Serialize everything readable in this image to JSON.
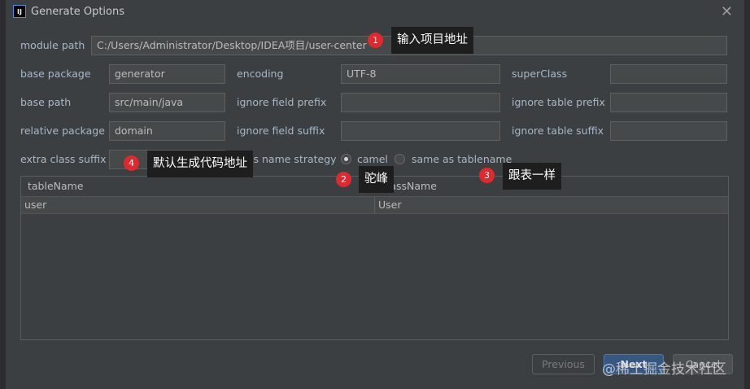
{
  "window": {
    "title": "Generate Options",
    "logo_text": "IJ"
  },
  "form": {
    "module_path": {
      "label": "module path",
      "value": "C:/Users/Administrator/Desktop/IDEA项目/user-center"
    },
    "base_package": {
      "label": "base package",
      "value": "generator"
    },
    "encoding": {
      "label": "encoding",
      "value": "UTF-8"
    },
    "super_class": {
      "label": "superClass",
      "value": ""
    },
    "base_path": {
      "label": "base path",
      "value": "src/main/java"
    },
    "ignore_field_prefix": {
      "label": "ignore field prefix",
      "value": ""
    },
    "ignore_table_prefix": {
      "label": "ignore table prefix",
      "value": ""
    },
    "relative_package": {
      "label": "relative package",
      "value": "domain"
    },
    "ignore_field_suffix": {
      "label": "ignore field suffix",
      "value": ""
    },
    "ignore_table_suffix": {
      "label": "ignore table suffix",
      "value": ""
    },
    "extra_class_suffix": {
      "label": "extra class suffix",
      "value": ""
    },
    "class_name_strategy": {
      "label": "class name strategy",
      "options": [
        "camel",
        "same as tablename"
      ],
      "selected": "camel"
    }
  },
  "table": {
    "columns": [
      "tableName",
      "className"
    ],
    "rows": [
      [
        "user",
        "User"
      ]
    ]
  },
  "buttons": {
    "previous": "Previous",
    "next": "Next",
    "cancel": "Cancel"
  },
  "annotations": [
    {
      "num": "1",
      "text": "输入项目地址"
    },
    {
      "num": "2",
      "text": "驼峰"
    },
    {
      "num": "3",
      "text": "跟表一样"
    },
    {
      "num": "4",
      "text": "默认生成代码地址"
    }
  ],
  "watermark": "@稀土掘金技术社区",
  "colors": {
    "dialog_bg": "#3c3f41",
    "field_bg": "#45494a",
    "badge": "#e0292f",
    "callout_bg": "#1e1e1e",
    "primary_button": "#365880"
  }
}
